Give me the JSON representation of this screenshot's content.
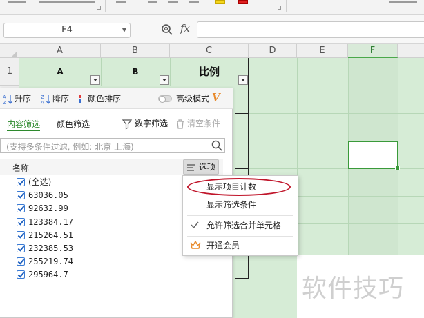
{
  "name_box": {
    "value": "F4"
  },
  "formula_bar": {
    "fx_label": "fx",
    "value": ""
  },
  "columns": [
    {
      "label": "A"
    },
    {
      "label": "B"
    },
    {
      "label": "C"
    },
    {
      "label": "D"
    },
    {
      "label": "E"
    },
    {
      "label": "F"
    }
  ],
  "rows": [
    {
      "label": "1"
    }
  ],
  "header_cells": {
    "a": "A",
    "b": "B",
    "c": "比例"
  },
  "filter_panel": {
    "sort": {
      "asc": "升序",
      "desc": "降序",
      "color_sort": "颜色排序",
      "advanced_mode": "高级模式",
      "vip_badge": "V"
    },
    "tabs": {
      "content_filter": "内容筛选",
      "color_filter": "颜色筛选"
    },
    "tools": {
      "number_filter": "数字筛选",
      "clear": "清空条件"
    },
    "search": {
      "placeholder": "(支持多条件过滤, 例如: 北京 上海)"
    },
    "list_header": {
      "name": "名称",
      "options": "选项"
    },
    "items": [
      {
        "label": "(全选)",
        "checked": true
      },
      {
        "label": "63036.05",
        "checked": true
      },
      {
        "label": "92632.99",
        "checked": true
      },
      {
        "label": "123384.17",
        "checked": true
      },
      {
        "label": "215264.51",
        "checked": true
      },
      {
        "label": "232385.53",
        "checked": true
      },
      {
        "label": "255219.74",
        "checked": true
      },
      {
        "label": "295964.7",
        "checked": true
      }
    ]
  },
  "options_menu": {
    "items": [
      {
        "label": "显示项目计数",
        "highlighted": true
      },
      {
        "label": "显示筛选条件",
        "checked": false
      },
      {
        "label": "允许筛选合并单元格",
        "checked": true
      },
      {
        "label": "开通会员",
        "icon": "crown-icon"
      }
    ]
  },
  "watermark": "软件技巧",
  "colors": {
    "selection_green": "#3a9a3a",
    "tab_active": "#2d8a2d",
    "annotation_red": "#c0152a",
    "crown": "#e8892a"
  }
}
